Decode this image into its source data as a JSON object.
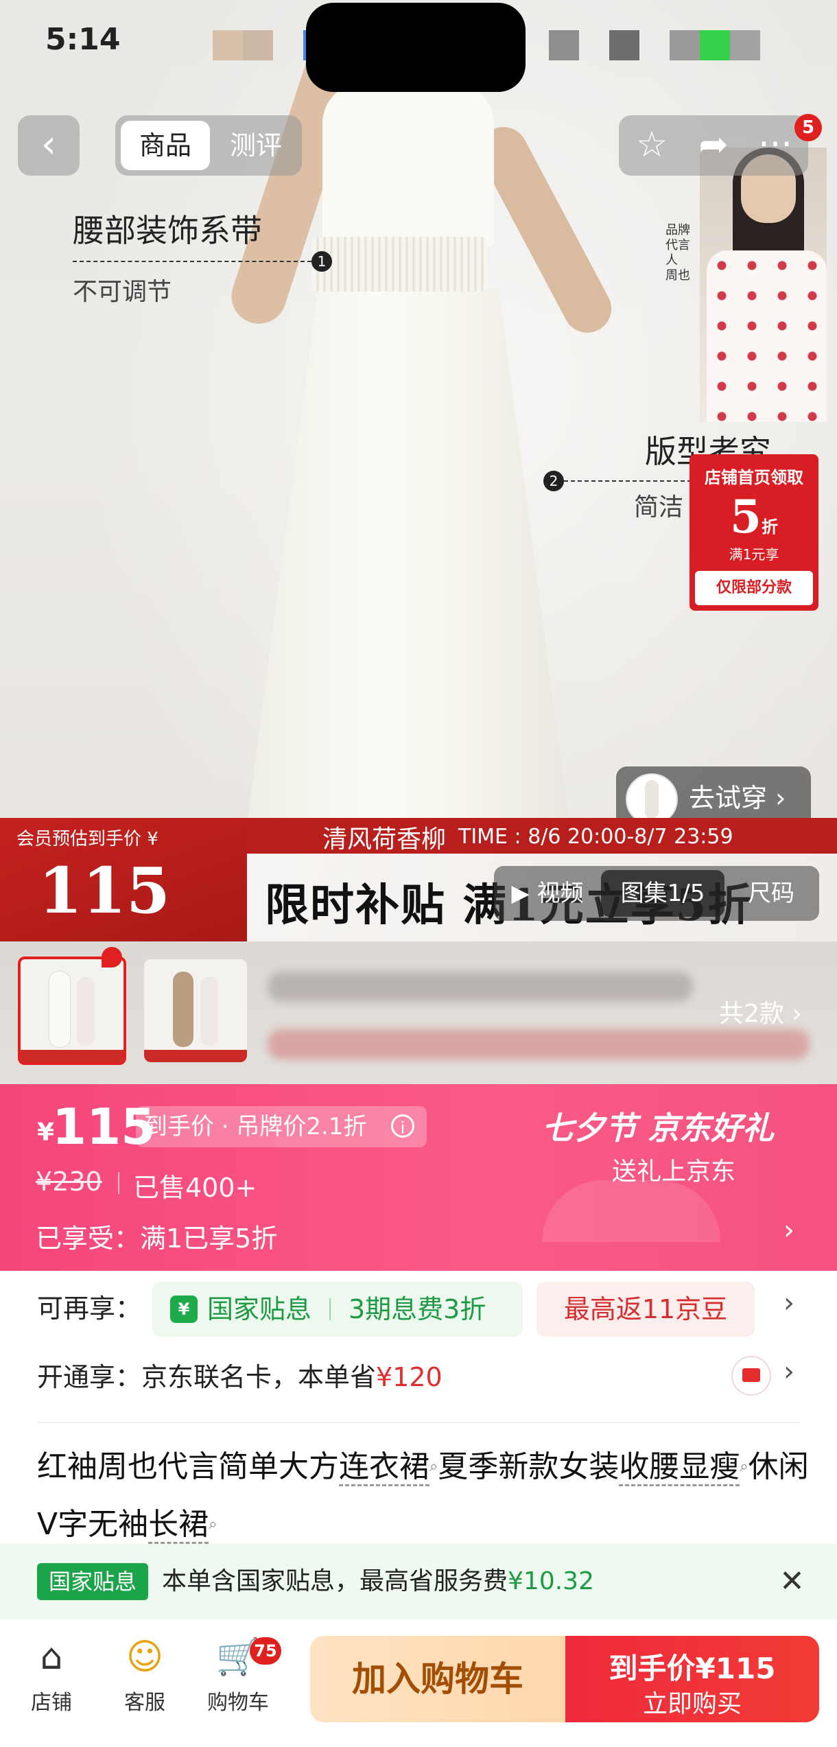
{
  "status_bar": {
    "time": "5:14"
  },
  "nav": {
    "back_icon": "chevron-left-icon",
    "tabs": [
      {
        "label": "商品",
        "active": true
      },
      {
        "label": "测评",
        "active": false
      }
    ],
    "favorite_icon": "star-icon",
    "share_icon": "share-icon",
    "more_icon": "more-icon",
    "more_badge": "5"
  },
  "hero": {
    "annotations": [
      {
        "title": "腰部装饰系带",
        "subtitle": "不可调节",
        "num": "1"
      },
      {
        "title": "版型考究",
        "subtitle": "简洁",
        "num": "2"
      }
    ],
    "ambassador_text": "品牌代言人 周也",
    "shop_coupon": {
      "top": "店铺首页领取",
      "value": "5",
      "unit": "折",
      "sub": "满1元享",
      "footer": "仅限部分款"
    },
    "try_on": "去试穿 ›"
  },
  "promo": {
    "member_label": "会员预估到手价 ¥",
    "member_price": "115",
    "event_name": "清风荷香柳",
    "timer": "TIME : 8/6 20:00-8/7 23:59",
    "headline": "限时补贴  满1元立享5折"
  },
  "media_tabs": [
    {
      "label": "▶ 视频",
      "active": false
    },
    {
      "label": "图集1/5",
      "active": true
    },
    {
      "label": "尺码",
      "active": false
    }
  ],
  "variants": {
    "more": "共2款 ›",
    "count": 2
  },
  "price": {
    "currency": "¥",
    "amount": "115",
    "pill": "到手价 · 吊牌价2.1折",
    "info_icon": "info-icon",
    "original": "¥230",
    "sold": "已售400+",
    "enjoyed": "已享受：满1已享5折",
    "festival": "七夕节  京东好礼",
    "festival_sub": "送礼上京东",
    "colors": {
      "bg": "#f94f80"
    }
  },
  "benefits": {
    "row1_label": "可再享：",
    "subsidy_icon_text": "¥",
    "subsidy": "国家贴息",
    "installment": "3期息费3折",
    "jd_beans": "最高返11京豆",
    "row2_label": "开通享：",
    "card_text_prefix": "京东联名卡，本单省",
    "card_saving": "¥120"
  },
  "title": {
    "parts": [
      {
        "text": "红袖周也代言简单大方",
        "u": false
      },
      {
        "text": "连衣裙",
        "u": true
      },
      {
        "text": "夏季新款女装",
        "u": false
      },
      {
        "text": "收腰显瘦",
        "u": true
      },
      {
        "text": "休闲V字无袖",
        "u": false
      },
      {
        "text": "长裙",
        "u": true
      }
    ]
  },
  "notice": {
    "tag": "国家贴息",
    "text": "本单含国家贴息，最高省服务费",
    "amount": "¥10.32"
  },
  "bottom_bar": {
    "tabs": [
      {
        "label": "店铺",
        "icon": "store-icon"
      },
      {
        "label": "客服",
        "icon": "customer-service-icon"
      },
      {
        "label": "购物车",
        "icon": "cart-icon",
        "badge": "75"
      }
    ],
    "add_to_cart": "加入购物车",
    "buy_line1": "到手价¥115",
    "buy_line2": "立即购买"
  }
}
